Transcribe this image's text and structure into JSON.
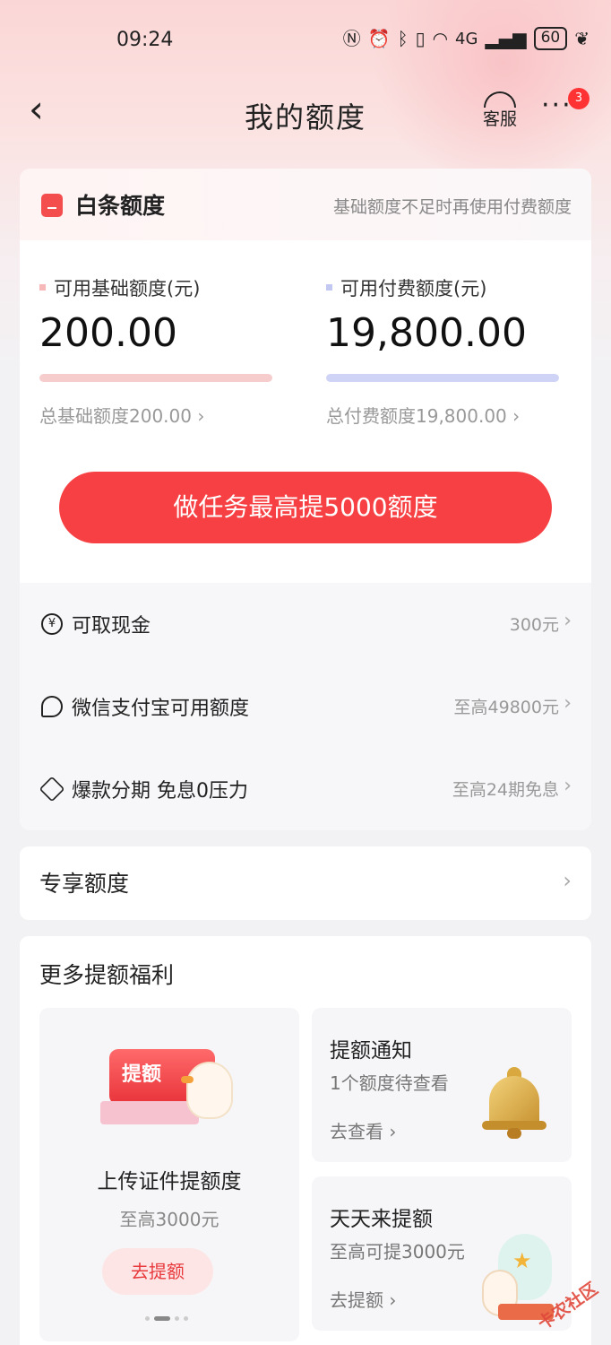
{
  "status_bar": {
    "time": "09:24",
    "network": "4G",
    "battery": "60"
  },
  "header": {
    "back_icon": "‹",
    "title": "我的额度",
    "service_label": "客服",
    "more_icon": "···",
    "badge_count": "3"
  },
  "credit": {
    "title": "白条额度",
    "note": "基础额度不足时再使用付费额度",
    "basic": {
      "label": "可用基础额度(元)",
      "value": "200.00",
      "total": "总基础额度200.00 ›",
      "available_fraction": 1.0,
      "color": "#f7cccc"
    },
    "paid": {
      "label": "可用付费额度(元)",
      "value": "19,800.00",
      "total": "总付费额度19,800.00 ›",
      "available_fraction": 1.0,
      "color": "#cfd4f7"
    },
    "task_button": "做任务最高提5000额度"
  },
  "list": [
    {
      "icon": "yuan-icon",
      "glyph": "¥",
      "label": "可取现金",
      "value": "300元"
    },
    {
      "icon": "chat-icon",
      "glyph": "",
      "label": "微信支付宝可用额度",
      "value": "至高49800元"
    },
    {
      "icon": "diamond-icon",
      "glyph": "",
      "label": "爆款分期 免息0压力",
      "value": "至高24期免息"
    }
  ],
  "exclusive": {
    "label": "专享额度"
  },
  "more_benefits": {
    "title": "更多提额福利",
    "upload": {
      "badge_text": "提额",
      "title": "上传证件提额度",
      "sub": "至高3000元",
      "button": "去提额"
    },
    "notice": {
      "title": "提额通知",
      "sub": "1个额度待查看",
      "link": "去查看 ›"
    },
    "daily": {
      "title": "天天来提额",
      "sub": "至高可提3000元",
      "link": "去提额 ›"
    }
  },
  "watermark": "卡农社区",
  "colors": {
    "accent": "#f74043",
    "badge": "#ff3333"
  }
}
